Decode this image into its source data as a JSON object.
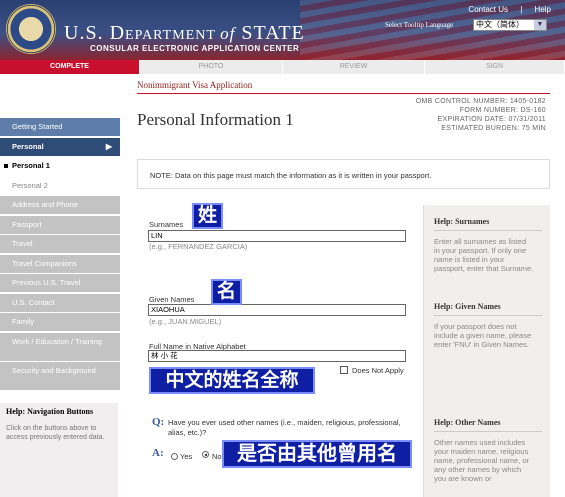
{
  "header": {
    "top_links": [
      "Contact Us",
      "Help"
    ],
    "dept_prefix": "U.S. D",
    "dept_main": "EPARTMENT ",
    "dept_of": "of",
    "dept_state": " STATE",
    "subtitle": "CONSULAR ELECTRONIC APPLICATION CENTER",
    "tooltip_language_label": "Select Tooltip Language",
    "tooltip_language_value": "中文（简体）"
  },
  "steps": [
    {
      "label": "COMPLETE",
      "active": true
    },
    {
      "label": "PHOTO",
      "active": false
    },
    {
      "label": "REVIEW",
      "active": false
    },
    {
      "label": "SIGN",
      "active": false
    }
  ],
  "sidebar": {
    "items": [
      {
        "label": "Getting Started"
      },
      {
        "label": "Personal"
      },
      {
        "label": "Personal 1"
      },
      {
        "label": "Personal 2"
      },
      {
        "label": "Address and Phone"
      },
      {
        "label": "Passport"
      },
      {
        "label": "Travel"
      },
      {
        "label": "Travel Companions"
      },
      {
        "label": "Previous U.S. Travel"
      },
      {
        "label": "U.S. Contact"
      },
      {
        "label": "Family"
      },
      {
        "label": "Work / Education / Training"
      },
      {
        "label": "Security and Background"
      }
    ],
    "help_title": "Help: Navigation Buttons",
    "help_text": "Click on the buttons above to access previously entered data."
  },
  "main": {
    "application_title": "Nonimmigrant Visa Application",
    "page_title": "Personal Information 1",
    "omb": [
      "OMB CONTROL NUMBER: 1405-0182",
      "FORM NUMBER: DS-160",
      "EXPIRATION DATE: 07/31/2011",
      "ESTIMATED BURDEN: 75 MIN"
    ],
    "note": "NOTE: Data on this page must match the information as it is written in your passport."
  },
  "form": {
    "surnames_label": "Surnames",
    "surnames_value": "LIN",
    "surnames_hint": "(e.g., FERNANDEZ GARCIA)",
    "given_label": "Given Names",
    "given_value": "XIAOHUA",
    "given_hint": "(e.g., JUAN MIGUEL)",
    "native_label": "Full Name in Native Alphabet",
    "native_value": "林 小 花",
    "does_not_apply": "Does Not Apply",
    "q_marker": "Q:",
    "question": "Have you ever used other names (i.e., maiden, religious, professional, alias, etc.)?",
    "a_marker": "A:",
    "yes_label": "Yes",
    "no_label": "No"
  },
  "annotations": {
    "surname_cn": "姓",
    "given_cn": "名",
    "native_cn": "中文的姓名全称",
    "other_names_cn": "是否由其他曾用名"
  },
  "help": {
    "surnames_title": "Help: Surnames",
    "surnames_text": "Enter all surnames as listed in your passport. If only one name is listed in your passport, enter that Surname.",
    "given_title": "Help: Given Names",
    "given_text": "If your passport does not include a given name, please enter 'FNU' in Given Names.",
    "other_title": "Help: Other Names",
    "other_text": "Other names used includes your maiden name, religious name, professional name, or any other names by which you are known or"
  }
}
